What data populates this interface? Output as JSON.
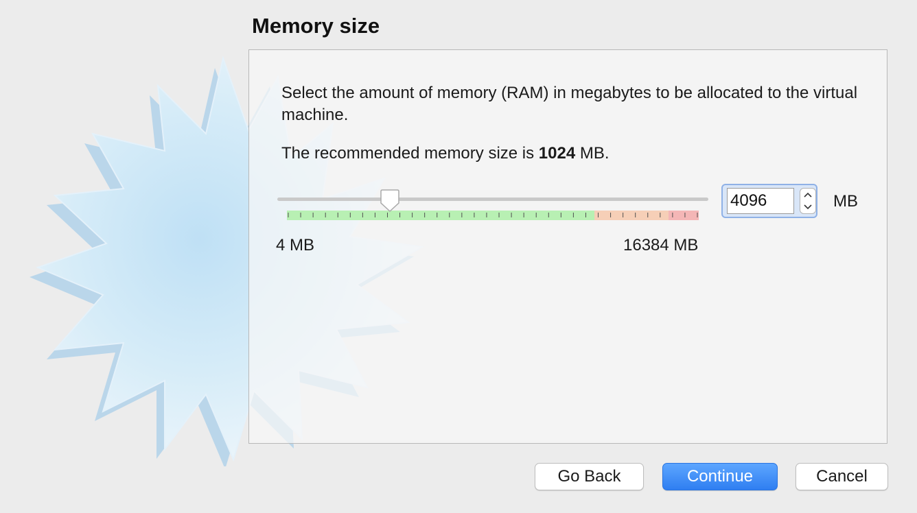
{
  "page": {
    "title": "Memory size"
  },
  "content": {
    "description": "Select the amount of memory (RAM) in megabytes to be allocated to the virtual machine.",
    "recommended_prefix": "The recommended memory size is ",
    "recommended_value": "1024",
    "recommended_suffix": " MB."
  },
  "slider": {
    "min_label": "4 MB",
    "max_label": "16384 MB",
    "current_value_mb": 4096,
    "min_mb": 4,
    "max_mb": 16384,
    "recommended_ranges": {
      "green": "#b8f0b3",
      "orange": "#f6cfb7",
      "red": "#f4b6b6"
    }
  },
  "spinbox": {
    "value": "4096",
    "unit": "MB",
    "up_icon": "chevron-up-icon",
    "down_icon": "chevron-down-icon"
  },
  "buttons": {
    "go_back": "Go Back",
    "continue": "Continue",
    "cancel": "Cancel"
  },
  "colors": {
    "primary_button": "#2f7ef1",
    "focus_ring": "#8fb1e6",
    "background": "#ececec"
  },
  "decoration": {
    "watermark_icon": "starburst-badge-icon"
  }
}
